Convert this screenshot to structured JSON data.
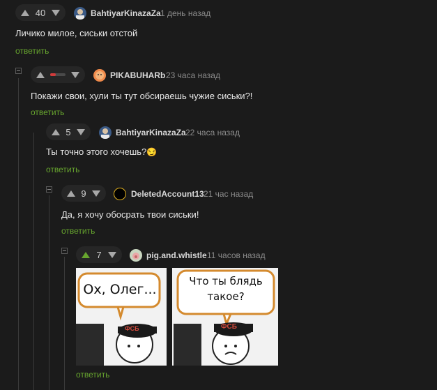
{
  "comments": [
    {
      "rating": "40",
      "user": "BahtiyarKinazaZa",
      "time": "1 день назад",
      "text": "Личико милое, сиськи отстой",
      "reply": "ответить"
    },
    {
      "rating": "",
      "user": "PIKABUHARb",
      "time": "23 часа назад",
      "text": "Покажи свои, хули ты тут обсираешь чужие сиськи?!",
      "reply": "ответить"
    },
    {
      "rating": "5",
      "user": "BahtiyarKinazaZa",
      "time": "22 часа назад",
      "text": "Ты точно этого хочешь?",
      "emoji": "😏",
      "reply": "ответить"
    },
    {
      "rating": "9",
      "user": "DeletedAccount13",
      "time": "21 час назад",
      "text": "Да, я хочу обосрать твои сиськи!",
      "reply": "ответить"
    },
    {
      "rating": "7",
      "user": "pig.and.whistle",
      "time": "11 часов назад",
      "reply": "ответить",
      "image": {
        "left_caption": "Ох, Олег...",
        "right_caption_1": "Что ты блядь",
        "right_caption_2": "такое?",
        "badge": "ФСБ"
      }
    }
  ],
  "colors": {
    "accent": "#67a52e",
    "background": "#1b1b1b",
    "rating_bar_negative": "#d03b3b"
  },
  "icons": [
    "arrow-up-icon",
    "arrow-down-icon",
    "collapse-icon"
  ]
}
